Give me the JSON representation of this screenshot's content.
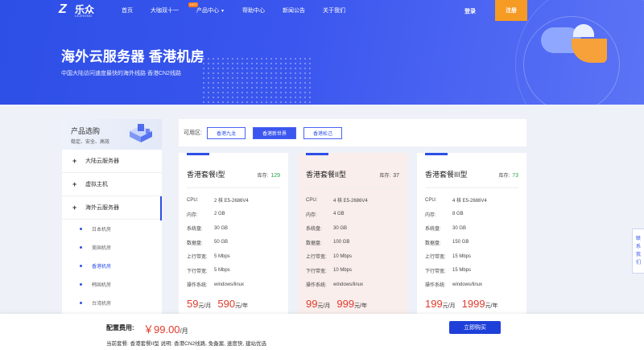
{
  "header": {
    "logo_text": "乐众",
    "logo_sub": "LEZHONG",
    "nav": [
      {
        "label": "首页"
      },
      {
        "label": "大咖双十一",
        "badge": "HOT"
      },
      {
        "label": "产品中心",
        "has_caret": true
      },
      {
        "label": "帮助中心"
      },
      {
        "label": "新闻公告"
      },
      {
        "label": "关于我们"
      }
    ],
    "login": "登录",
    "register": "注册"
  },
  "hero": {
    "title": "海外云服务器 香港机房",
    "subtitle": "中国大陆访问速度最快的海外线路 香港CN2线路"
  },
  "sidebar": {
    "title": "产品选购",
    "desc": "稳定、安全、高效",
    "items": [
      {
        "label": "大陆云服务器",
        "icon": "plus-icon"
      },
      {
        "label": "虚拟主机",
        "icon": "plus-icon"
      },
      {
        "label": "海外云服务器",
        "icon": "plus-icon"
      }
    ],
    "subitems": [
      {
        "label": "日本机房",
        "active": false
      },
      {
        "label": "美国机房",
        "active": false
      },
      {
        "label": "香港机房",
        "active": true
      },
      {
        "label": "韩国机房",
        "active": false
      },
      {
        "label": "台湾机房",
        "active": false
      }
    ]
  },
  "regions": {
    "label": "可用区:",
    "options": [
      {
        "label": "香港九龙",
        "active": false
      },
      {
        "label": "香港新世界",
        "active": true
      },
      {
        "label": "香港松己",
        "active": false
      }
    ]
  },
  "plans": [
    {
      "name": "香港套餐I型",
      "stock_label": "库存:",
      "stock": "129",
      "specs": [
        {
          "k": "CPU:",
          "v": "2 核 E5-2686V4"
        },
        {
          "k": "内存:",
          "v": "2 GB"
        },
        {
          "k": "系统盘:",
          "v": "30 GB"
        },
        {
          "k": "数据盘:",
          "v": "50 GB"
        },
        {
          "k": "上行带宽:",
          "v": "5 Mbps"
        },
        {
          "k": "下行带宽:",
          "v": "5 Mbps"
        },
        {
          "k": "操作系统:",
          "v": "windows/linux"
        }
      ],
      "price_month": "59",
      "unit_month": "元/月",
      "price_year": "590",
      "unit_year": "元/年",
      "highlight": false
    },
    {
      "name": "香港套餐II型",
      "stock_label": "库存:",
      "stock": "37",
      "specs": [
        {
          "k": "CPU:",
          "v": "4 核 E5-2686V4"
        },
        {
          "k": "内存:",
          "v": "4 GB"
        },
        {
          "k": "系统盘:",
          "v": "30 GB"
        },
        {
          "k": "数据盘:",
          "v": "100 GB"
        },
        {
          "k": "上行带宽:",
          "v": "10 Mbps"
        },
        {
          "k": "下行带宽:",
          "v": "10 Mbps"
        },
        {
          "k": "操作系统:",
          "v": "windows/linux"
        }
      ],
      "price_month": "99",
      "unit_month": "元/月",
      "price_year": "999",
      "unit_year": "元/年",
      "highlight": true
    },
    {
      "name": "香港套餐III型",
      "stock_label": "库存:",
      "stock": "73",
      "specs": [
        {
          "k": "CPU:",
          "v": "4 核 E5-2686V4"
        },
        {
          "k": "内存:",
          "v": "8 GB"
        },
        {
          "k": "系统盘:",
          "v": "30 GB"
        },
        {
          "k": "数据盘:",
          "v": "150 GB"
        },
        {
          "k": "上行带宽:",
          "v": "15 Mbps"
        },
        {
          "k": "下行带宽:",
          "v": "15 Mbps"
        },
        {
          "k": "操作系统:",
          "v": "windows/linux"
        }
      ],
      "price_month": "199",
      "unit_month": "元/月",
      "price_year": "1999",
      "unit_year": "元/年",
      "highlight": false
    }
  ],
  "float_tab": [
    "联",
    "系",
    "我",
    "们"
  ],
  "bottom": {
    "cfg_label": "配置费用:",
    "cfg_price": "￥99.00",
    "cfg_unit": "/月",
    "current": "当前套餐: 香港套餐II型 说明: 香港CN2线路, 免备案, 速度快, 建站优选",
    "buy": "立即购买"
  },
  "colors": {
    "brand": "#2d4fe6",
    "accent": "#f59a23",
    "price": "#e23a2b",
    "stock": "#2aa24a"
  }
}
